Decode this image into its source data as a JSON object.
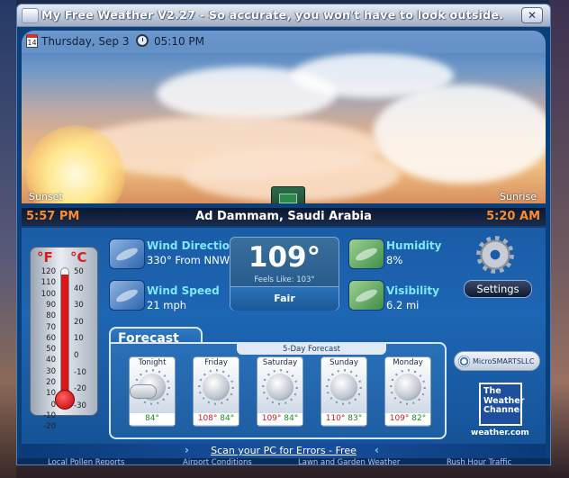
{
  "window": {
    "title": "My Free Weather V2.27 - So accurate, you won't have to look outside.",
    "close_label": "✕"
  },
  "header": {
    "calendar_day": "14",
    "date": "Thursday, Sep 3",
    "time": "05:10 PM"
  },
  "location": {
    "city": "Ad Dammam, Saudi Arabia",
    "sunset_label": "Sunset",
    "sunset_time": "5:57 PM",
    "sunrise_label": "Sunrise",
    "sunrise_time": "5:20 AM"
  },
  "thermometer": {
    "f_label": "°F",
    "c_label": "°C",
    "f_ticks": [
      "120",
      "110",
      "100",
      "90",
      "80",
      "70",
      "60",
      "50",
      "40",
      "30",
      "20",
      "10",
      "0",
      "-10",
      "-20"
    ],
    "c_ticks": [
      "50",
      "40",
      "30",
      "20",
      "10",
      "0",
      "-10",
      "-20",
      "-30"
    ],
    "level_fraction": 0.95
  },
  "current": {
    "temp": "109°",
    "feels_like": "Feels Like: 103°",
    "condition": "Fair"
  },
  "details": {
    "wind_direction_label": "Wind Direction",
    "wind_direction_value": "330° From NNW",
    "wind_speed_label": "Wind Speed",
    "wind_speed_value": "21 mph",
    "humidity_label": "Humidity",
    "humidity_value": "8%",
    "visibility_label": "Visibility",
    "visibility_value": "6.2 mi"
  },
  "settings": {
    "label": "Settings"
  },
  "forecast": {
    "title": "Forecast",
    "subtitle": "5-Day Forecast",
    "days": [
      {
        "name": "Tonight",
        "hi": "",
        "lo": "84°",
        "icon": "partly-cloudy-icon"
      },
      {
        "name": "Friday",
        "hi": "108°",
        "lo": "84°",
        "icon": "sunny-icon"
      },
      {
        "name": "Saturday",
        "hi": "109°",
        "lo": "84°",
        "icon": "sunny-icon"
      },
      {
        "name": "Sunday",
        "hi": "110°",
        "lo": "83°",
        "icon": "sunny-icon"
      },
      {
        "name": "Monday",
        "hi": "109°",
        "lo": "82°",
        "icon": "sunny-icon"
      }
    ]
  },
  "brands": {
    "microsmarts": "MicroSMARTSLLC",
    "twc_line1": "The",
    "twc_line2": "Weather",
    "twc_line3": "Channel",
    "twc_url": "weather.com"
  },
  "scan": {
    "link": "Scan your PC for Errors - Free",
    "arrow_left": "›",
    "arrow_right": "‹"
  },
  "bottom_links": [
    "Local Pollen Reports",
    "Airport Conditions",
    "Lawn and Garden Weather",
    "Rush Hour Traffic"
  ],
  "colors": {
    "label": "#7fe6ff",
    "sun_time": "#ff8a2a",
    "hi": "#d41a1a",
    "lo": "#1e8a1e"
  }
}
